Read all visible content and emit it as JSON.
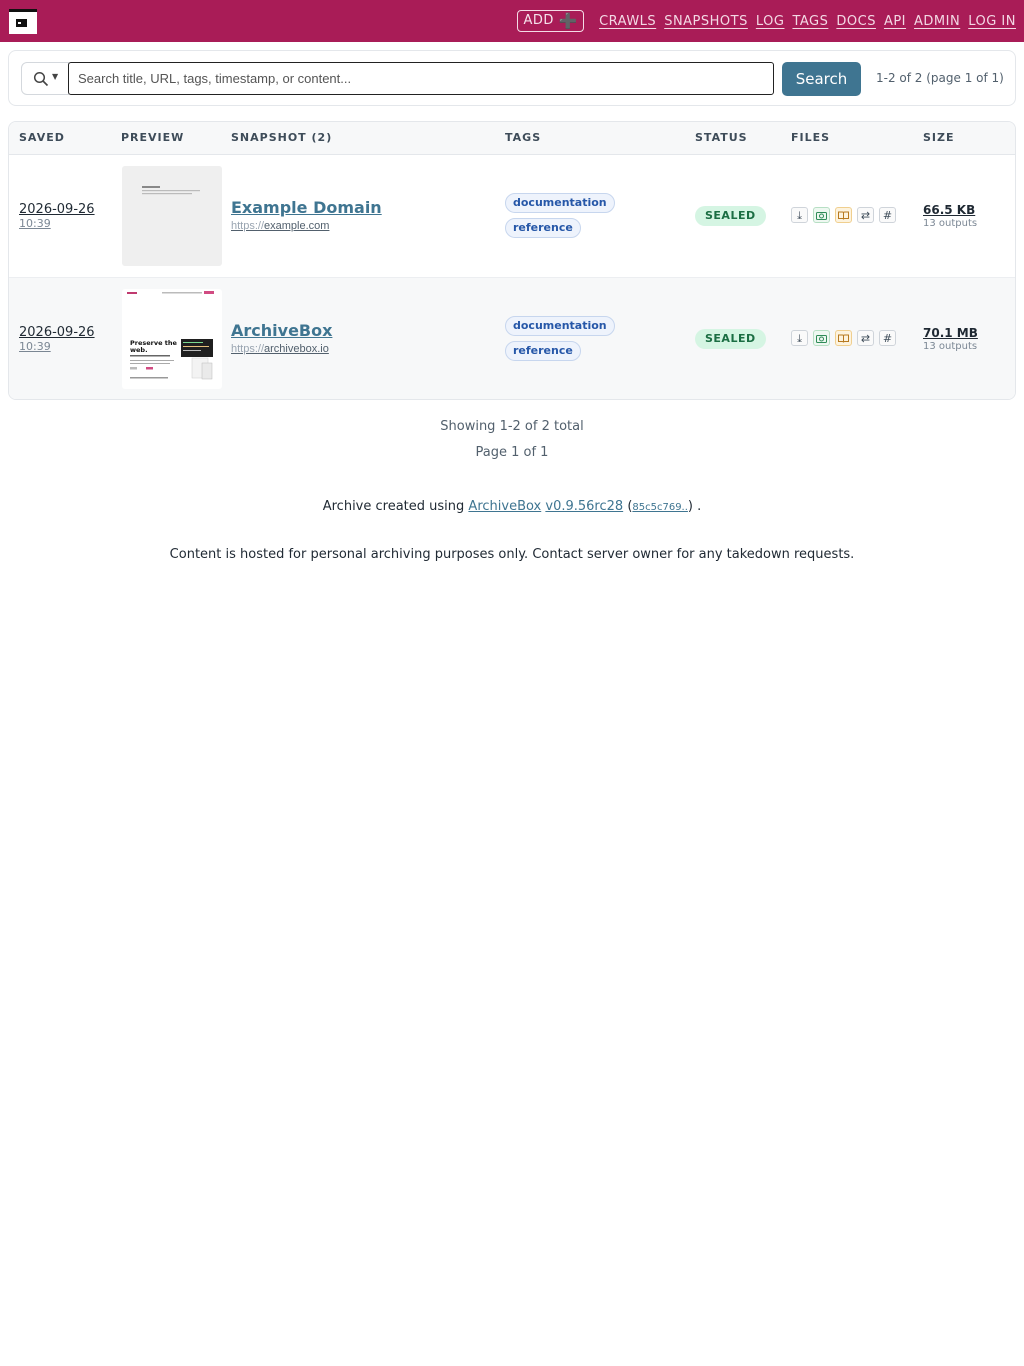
{
  "header": {
    "logo_icon": "archive-box-icon",
    "add_label": "ADD",
    "add_icon": "➕",
    "nav": [
      "CRAWLS",
      "SNAPSHOTS",
      "LOG",
      "TAGS",
      "DOCS",
      "API",
      "ADMIN",
      "LOG IN"
    ]
  },
  "search": {
    "mode_icon": "search-icon",
    "placeholder": "Search title, URL, tags, timestamp, or content...",
    "button_label": "Search",
    "count": "1-2 of 2 (page 1 of 1)"
  },
  "table": {
    "headers": [
      "SAVED",
      "PREVIEW",
      "SNAPSHOT (2)",
      "TAGS",
      "STATUS",
      "FILES",
      "SIZE"
    ],
    "rows": [
      {
        "date": "2026-09-26",
        "time": "10:39",
        "title": "Example Domain",
        "url_scheme": "https://",
        "url_host": "example.com",
        "tags": [
          "documentation",
          "reference"
        ],
        "status": "SEALED",
        "size": "66.5 KB",
        "outputs": "13 outputs"
      },
      {
        "date": "2026-09-26",
        "time": "10:39",
        "title": "ArchiveBox",
        "url_scheme": "https://",
        "url_host": "archivebox.io",
        "tags": [
          "documentation",
          "reference"
        ],
        "status": "SEALED",
        "size": "70.1 MB",
        "outputs": "13 outputs",
        "preview_text": [
          "Preserve the",
          "web."
        ]
      }
    ],
    "file_icons": [
      "download-icon",
      "camera-icon",
      "book-icon",
      "arrows-swap-icon",
      "hash-icon"
    ]
  },
  "footer": {
    "showing": "Showing 1-2 of 2 total",
    "page": "Page 1 of 1",
    "credit_prefix": "Archive created using",
    "archivebox_link": "ArchiveBox",
    "version": "v0.9.56rc28",
    "open_paren": "(",
    "commit": "85c5c769..",
    "close_paren": ") .",
    "notice": "Content is hosted for personal archiving purposes only. Contact server owner for any takedown requests."
  },
  "colors": {
    "header_bg": "#a91c57",
    "accent": "#3f7591",
    "status_bg": "#d5f5e3",
    "status_text": "#1b6e43"
  }
}
